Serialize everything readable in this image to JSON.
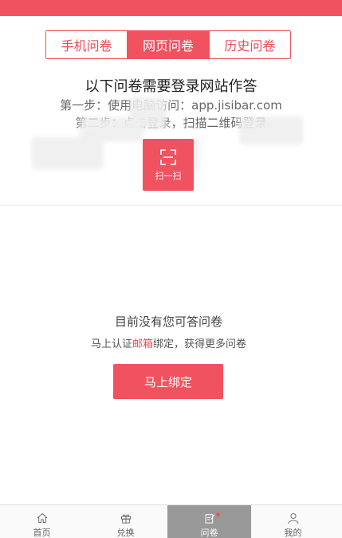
{
  "tabs": [
    {
      "label": "手机问卷",
      "active": false
    },
    {
      "label": "网页问卷",
      "active": true
    },
    {
      "label": "历史问卷",
      "active": false
    }
  ],
  "login_section": {
    "title": "以下问卷需要登录网站作答",
    "step1": "第一步：使用电脑访问：app.jisibar.com",
    "step2": "第二步：点击登录，扫描二维码登录",
    "scan_button_label": "扫一扫"
  },
  "empty_state": {
    "title": "目前没有您可答问卷",
    "subtitle_prefix": "马上认证",
    "subtitle_link": "邮箱",
    "subtitle_suffix": "绑定，获得更多问卷",
    "bind_button": "马上绑定"
  },
  "bottom_nav": [
    {
      "label": "首页",
      "icon": "home-icon",
      "active": false
    },
    {
      "label": "兑换",
      "icon": "gift-icon",
      "active": false
    },
    {
      "label": "问卷",
      "icon": "survey-edit-icon",
      "active": true,
      "badge": true
    },
    {
      "label": "我的",
      "icon": "user-icon",
      "active": false
    }
  ],
  "colors": {
    "accent": "#f0525f",
    "active_nav_bg": "#999999",
    "link": "#e84a57"
  }
}
